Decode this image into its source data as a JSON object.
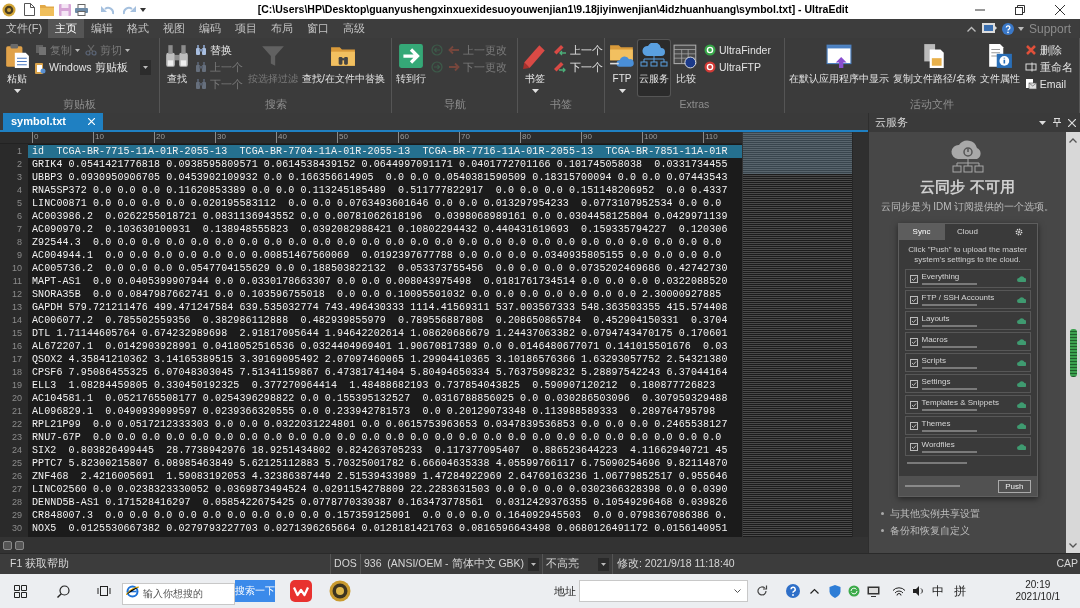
{
  "window": {
    "title": "[C:\\Users\\HP\\Desktop\\guanyushengxinxuexidesuoyouwenjian1\\9.18jiyinwenjian\\4idzhuanhuang\\symbol.txt] - UltraEdit"
  },
  "menu": {
    "items": [
      {
        "label": "文件(F)",
        "selected": false
      },
      {
        "label": "主页",
        "selected": true
      },
      {
        "label": "编辑",
        "selected": false
      },
      {
        "label": "格式",
        "selected": false
      },
      {
        "label": "视图",
        "selected": false
      },
      {
        "label": "编码",
        "selected": false
      },
      {
        "label": "项目",
        "selected": false
      },
      {
        "label": "布局",
        "selected": false
      },
      {
        "label": "窗口",
        "selected": false
      },
      {
        "label": "高级",
        "selected": false
      }
    ],
    "support": "Support"
  },
  "ribbon": {
    "groups": [
      {
        "label": "剪贴板",
        "columns": [
          {
            "kind": "large",
            "label": "粘贴",
            "dropdown": true,
            "disabled": false,
            "pressed": false
          },
          {
            "kind": "stack",
            "rows": [
              [
                {
                  "kind": "button",
                  "label": "复制",
                  "dropdown": true,
                  "disabled": true
                },
                {
                  "kind": "button",
                  "label": "剪切",
                  "dropdown": true,
                  "disabled": true
                }
              ],
              [
                {
                  "kind": "combo",
                  "label": "Windows 剪贴板",
                  "dropdown": true,
                  "disabled": false
                }
              ]
            ]
          }
        ]
      },
      {
        "label": "搜索",
        "columns": [
          {
            "kind": "large",
            "label": "查找",
            "dropdown": false,
            "disabled": false,
            "pressed": false
          },
          {
            "kind": "stack",
            "rows": [
              [
                {
                  "kind": "button",
                  "label": "替换",
                  "dropdown": false,
                  "disabled": false
                }
              ],
              [
                {
                  "kind": "button",
                  "label": "上一个",
                  "dropdown": false,
                  "disabled": true
                }
              ],
              [
                {
                  "kind": "button",
                  "label": "下一个",
                  "dropdown": false,
                  "disabled": true
                }
              ]
            ]
          },
          {
            "kind": "large",
            "label": "按选择过滤",
            "dropdown": false,
            "disabled": true,
            "pressed": false
          },
          {
            "kind": "large",
            "label": "查找/在文件中替换",
            "dropdown": false,
            "disabled": false,
            "pressed": false
          }
        ]
      },
      {
        "label": "导航",
        "columns": [
          {
            "kind": "large",
            "label": "转到行",
            "dropdown": false,
            "disabled": false,
            "pressed": false
          },
          {
            "kind": "stack",
            "rows": [
              [
                {
                  "kind": "icon",
                  "dropdown": false,
                  "disabled": true
                },
                {
                  "kind": "button",
                  "label": "上一更改",
                  "dropdown": false,
                  "disabled": true
                }
              ],
              [
                {
                  "kind": "icon",
                  "dropdown": false,
                  "disabled": true
                },
                {
                  "kind": "button",
                  "label": "下一更改",
                  "dropdown": false,
                  "disabled": true
                }
              ]
            ]
          }
        ]
      },
      {
        "label": "书签",
        "columns": [
          {
            "kind": "large",
            "label": "书签",
            "dropdown": true,
            "disabled": false,
            "pressed": false
          },
          {
            "kind": "stack",
            "rows": [
              [
                {
                  "kind": "button",
                  "label": "上一个",
                  "dropdown": false,
                  "disabled": false
                }
              ],
              [
                {
                  "kind": "button",
                  "label": "下一个",
                  "dropdown": false,
                  "disabled": false
                }
              ]
            ]
          }
        ]
      },
      {
        "label": "Extras",
        "columns": [
          {
            "kind": "large",
            "label": "FTP",
            "dropdown": true,
            "disabled": false,
            "pressed": false
          },
          {
            "kind": "large",
            "label": "云服务",
            "dropdown": false,
            "disabled": false,
            "pressed": true
          },
          {
            "kind": "large",
            "label": "比较",
            "dropdown": false,
            "disabled": false,
            "pressed": false
          },
          {
            "kind": "stack",
            "rows": [
              [
                {
                  "kind": "button",
                  "label": "UltraFinder",
                  "dropdown": false,
                  "disabled": false
                }
              ],
              [
                {
                  "kind": "button",
                  "label": "UltraFTP",
                  "dropdown": false,
                  "disabled": false
                }
              ]
            ]
          }
        ]
      },
      {
        "label": "活动文件",
        "columns": [
          {
            "kind": "large",
            "label": "在默认应用程序中显示",
            "dropdown": false,
            "disabled": false,
            "pressed": false
          },
          {
            "kind": "large",
            "label": "复制文件路径/名称",
            "dropdown": false,
            "disabled": false,
            "pressed": false
          },
          {
            "kind": "large",
            "label": "文件属性",
            "dropdown": false,
            "disabled": false,
            "pressed": false
          },
          {
            "kind": "stack",
            "rows": [
              [
                {
                  "kind": "button",
                  "label": "删除",
                  "dropdown": false,
                  "disabled": false
                }
              ],
              [
                {
                  "kind": "button",
                  "label": "重命名",
                  "dropdown": false,
                  "disabled": false
                }
              ],
              [
                {
                  "kind": "button",
                  "label": "Email",
                  "dropdown": false,
                  "disabled": false
                }
              ]
            ]
          }
        ]
      }
    ]
  },
  "editor": {
    "tab": {
      "label": "symbol.txt",
      "selected": true
    },
    "ruler": [
      "0",
      "10",
      "20",
      "30",
      "40",
      "50",
      "60",
      "70",
      "80",
      "90",
      "100",
      "110"
    ],
    "lines": [
      {
        "number": "1",
        "text": "id  TCGA-BR-7715-11A-01R-2055-13  TCGA-BR-7704-11A-01R-2055-13  TCGA-BR-7716-11A-01R-2055-13  TCGA-BR-7851-11A-01R",
        "selected": true
      },
      {
        "number": "2",
        "text": "GRIK4 0.0541421776818 0.0938595809571 0.0614538439152 0.0644997091171 0.0401772701166 0.101745058038  0.0331734455",
        "selected": false
      },
      {
        "number": "3",
        "text": "UBBP3 0.0930950906705 0.0453902109932 0.0 0.166356614905  0.0 0.0 0.0540381590509 0.18315700094 0.0 0.0 0.07443543",
        "selected": false
      },
      {
        "number": "4",
        "text": "RNA5SP372 0.0 0.0 0.0 0.11620853389 0.0 0.0 0.113245185489  0.511777822917  0.0 0.0 0.0 0.151148206952  0.0 0.4337",
        "selected": false
      },
      {
        "number": "5",
        "text": "LINC00871 0.0 0.0 0.0 0.0 0.020195583112  0.0 0.0 0.0763493601646 0.0 0.0 0.013297954233  0.0773107952534 0.0 0.0",
        "selected": false
      },
      {
        "number": "6",
        "text": "AC003986.2  0.0262255018721 0.0831136943552 0.0 0.00781062618196  0.0398068989161 0.0 0.0304458125804 0.0429971139",
        "selected": false
      },
      {
        "number": "7",
        "text": "AC090970.2  0.103630100931  0.138948555823  0.0392082988421 0.10802294432 0.440431619693  0.159335794227  0.120306",
        "selected": false
      },
      {
        "number": "8",
        "text": "Z92544.3  0.0 0.0 0.0 0.0 0.0 0.0 0.0 0.0 0.0 0.0 0.0 0.0 0.0 0.0 0.0 0.0 0.0 0.0 0.0 0.0 0.0 0.0 0.0 0.0 0.0 0.0",
        "selected": false
      },
      {
        "number": "9",
        "text": "AC004944.1  0.0 0.0 0.0 0.0 0.0 0.0 0.00851467560069  0.0192397677788 0.0 0.0 0.0 0.0340935805155 0.0 0.0 0.0 0.0",
        "selected": false
      },
      {
        "number": "10",
        "text": "AC005736.2  0.0 0.0 0.0 0.0547704155629 0.0 0.188503822132  0.053373755456  0.0 0.0 0.0 0.0735202469686 0.42742730",
        "selected": false
      },
      {
        "number": "11",
        "text": "MAPT-AS1  0.0 0.0405399907944 0.0 0.0330178663307 0.0 0.0 0.008043975498  0.0181761734514 0.0 0.0 0.0 0.0322088520",
        "selected": false
      },
      {
        "number": "12",
        "text": "SNORA35B  0.0 0.0847987662741 0.0 0.103596755018  0.0 0.0 0.10095501032 0.0 0.0 0.0 0.0 0.0 0.0 0.0 2.30000927885",
        "selected": false
      },
      {
        "number": "13",
        "text": "GAPDH 579.721211476 499.471247584 639.535032774 743.496430333 1114.41569311 537.003567333 548.363503355 415.574408",
        "selected": false
      },
      {
        "number": "14",
        "text": "AC006077.2  0.785502559356  0.382986112888  0.482939855979  0.789556887808  0.208650865784  0.452904150331  0.3704",
        "selected": false
      },
      {
        "number": "15",
        "text": "DTL 1.71144605764 0.674232989698  2.91817095644 1.94642202614 1.08620686679 1.24437063382 0.0794743470175 0.170601",
        "selected": false
      },
      {
        "number": "16",
        "text": "AL672207.1  0.0142903928991 0.0418052516536 0.0324404969401 1.90670817389 0.0 0.0146480677071 0.141015501676  0.03",
        "selected": false
      },
      {
        "number": "17",
        "text": "QSOX2 4.35841210362 3.14165389515 3.39169095492 2.07097460065 1.29904410365 3.10186576366 1.63293057752 2.54321380",
        "selected": false
      },
      {
        "number": "18",
        "text": "CPSF6 7.95086455325 6.07048303045 7.51341159867 6.47381741404 5.80494650334 5.76375998232 5.28897542243 6.37044164",
        "selected": false
      },
      {
        "number": "19",
        "text": "ELL3  1.08284459805 0.330450192325  0.377270964414  1.48488682193 0.737854043825  0.590907120212  0.180877726823",
        "selected": false
      },
      {
        "number": "20",
        "text": "AC104581.1  0.0521765508177 0.0254396298822 0.0 0.155395132527  0.0316788856025 0.0 0.030286503096  0.307959329488",
        "selected": false
      },
      {
        "number": "21",
        "text": "AL096829.1  0.0490939099597 0.0239366320555 0.0 0.233942781573  0.0 0.20129073348 0.113988589333  0.289764795798",
        "selected": false
      },
      {
        "number": "22",
        "text": "RPL21P99  0.0 0.0517212333303 0.0 0.0 0.0322031224801 0.0 0.0615753963653 0.0347839536853 0.0 0.0 0.0 0.2465538127",
        "selected": false
      },
      {
        "number": "23",
        "text": "RNU7-67P  0.0 0.0 0.0 0.0 0.0 0.0 0.0 0.0 0.0 0.0 0.0 0.0 0.0 0.0 0.0 0.0 0.0 0.0 0.0 0.0 0.0 0.0 0.0 0.0 0.0 0.0",
        "selected": false
      },
      {
        "number": "24",
        "text": "SIX2  0.803826499445  28.7738942976 18.9251434802 0.824263705233  0.117377095407  0.886523644223  4.11662940721 45",
        "selected": false
      },
      {
        "number": "25",
        "text": "PPTC7 5.82300215807 6.08985463849 5.62125112883 5.70325001782 6.66604635338 4.05599766117 6.75090254696 9.82114870",
        "selected": false
      },
      {
        "number": "26",
        "text": "ZNF468  2.4216005691  1.59083192053 4.32386387449 2.51539433989 1.47284922969 2.64769163236 1.06779852517 0.955646",
        "selected": false
      },
      {
        "number": "27",
        "text": "LINC02560 0.0 0.0238323330052 0.0369873494524 0.0291154278809 22.2283631503 0.0 0.0 0.0 0.0302366328398 0.0 0.0390",
        "selected": false
      },
      {
        "number": "28",
        "text": "DENND5B-AS1 0.171528416297  0.0585422675425 0.0778770339387 0.163473778561  0.0312429376355 0.10549296468 0.039826",
        "selected": false
      },
      {
        "number": "29",
        "text": "CR848007.3  0.0 0.0 0.0 0.0 0.0 0.0 0.0 0.0 0.0 0.157359125091  0.0 0.0 0.0 0.164092945503  0.0 0.0798367086386 0.",
        "selected": false
      },
      {
        "number": "30",
        "text": "NOX5  0.0125530667382 0.0279793227703 0.0271396265664 0.0128181421763 0.0816596643498 0.0680126491172 0.0156140951",
        "selected": false
      }
    ]
  },
  "panel": {
    "title": "云服务",
    "heading": "云同步 不可用",
    "description": "云同步是为 IDM 订阅提供的一个选项。",
    "preview": {
      "tabs": [
        {
          "label": "Sync",
          "selected": true
        },
        {
          "label": "Cloud",
          "selected": false
        }
      ],
      "instruction": "Click \"Push\" to upload the master system's settings to the cloud.",
      "items": [
        {
          "title": "Everything",
          "checked": true
        },
        {
          "title": "FTP / SSH Accounts",
          "checked": true
        },
        {
          "title": "Layouts",
          "checked": true
        },
        {
          "title": "Macros",
          "checked": true
        },
        {
          "title": "Scripts",
          "checked": true
        },
        {
          "title": "Settings",
          "checked": true
        },
        {
          "title": "Templates & Snippets",
          "checked": true
        },
        {
          "title": "Themes",
          "checked": true
        },
        {
          "title": "Wordfiles",
          "checked": true
        }
      ],
      "button": "Push"
    },
    "bullets": [
      "与其他实例共享设置",
      "备份和恢复自定义"
    ]
  },
  "status_bar": {
    "help": "F1 获取帮助",
    "line_ending": "DOS",
    "encoding": "936  (ANSI/OEM - 简体中文 GBK)",
    "highlighting": "不高亮",
    "modified": "修改: 2021/9/18 11:18:40",
    "caps": "CAP"
  },
  "taskbar": {
    "search": {
      "placeholder": "输入你想搜的",
      "button": "搜索一下"
    },
    "address": {
      "label": "地址"
    },
    "ime": [
      "中",
      "拼"
    ],
    "clock": {
      "time": "20:19",
      "date": "2021/10/1"
    }
  }
}
